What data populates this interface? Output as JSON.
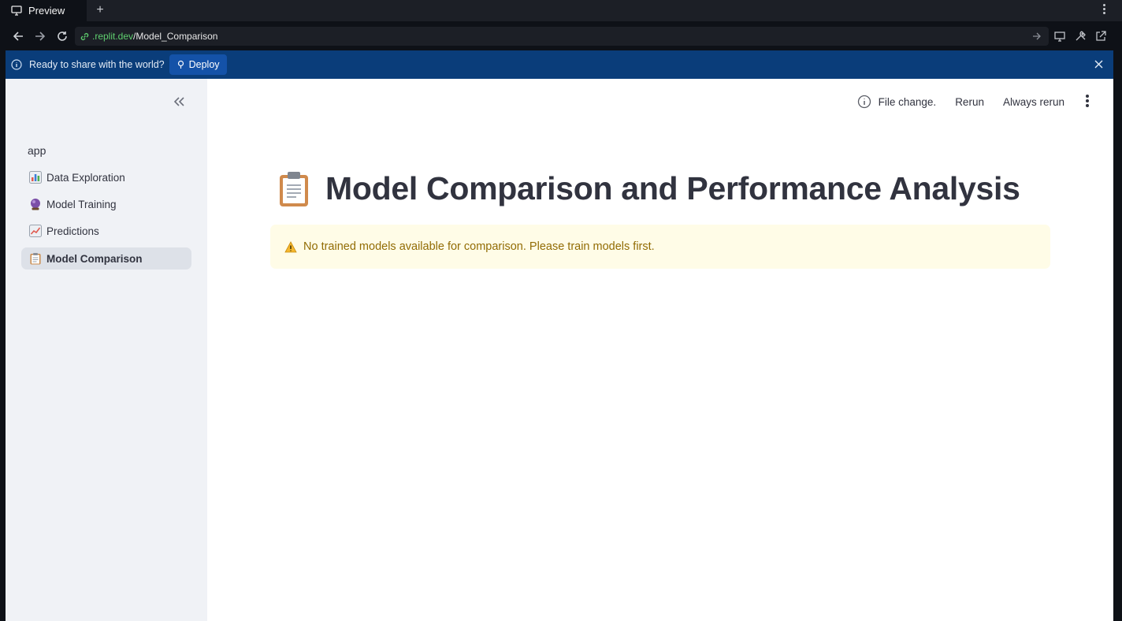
{
  "browser": {
    "tab_label": "Preview",
    "new_tab_symbol": "+",
    "url_domain": ".replit.dev",
    "url_path": "/Model_Comparison"
  },
  "banner": {
    "message": "Ready to share with the world?",
    "deploy_label": "Deploy"
  },
  "sidebar": {
    "app_label": "app",
    "items": [
      {
        "label": "Data Exploration",
        "icon": "bar-chart-icon"
      },
      {
        "label": "Model Training",
        "icon": "crystal-ball-icon"
      },
      {
        "label": "Predictions",
        "icon": "chart-increasing-icon"
      },
      {
        "label": "Model Comparison",
        "icon": "clipboard-icon",
        "active": true
      }
    ]
  },
  "status": {
    "file_change": "File change.",
    "rerun_label": "Rerun",
    "always_rerun_label": "Always rerun"
  },
  "page": {
    "title": "Model Comparison and Performance Analysis",
    "title_icon": "clipboard-icon",
    "warning": "No trained models available for comparison. Please train models first."
  },
  "colors": {
    "banner_bg": "#0a3d7a",
    "sidebar_bg": "#f0f2f6",
    "warning_bg": "#fffce7",
    "warning_text": "#926c05",
    "url_domain": "#5fcf6f"
  }
}
